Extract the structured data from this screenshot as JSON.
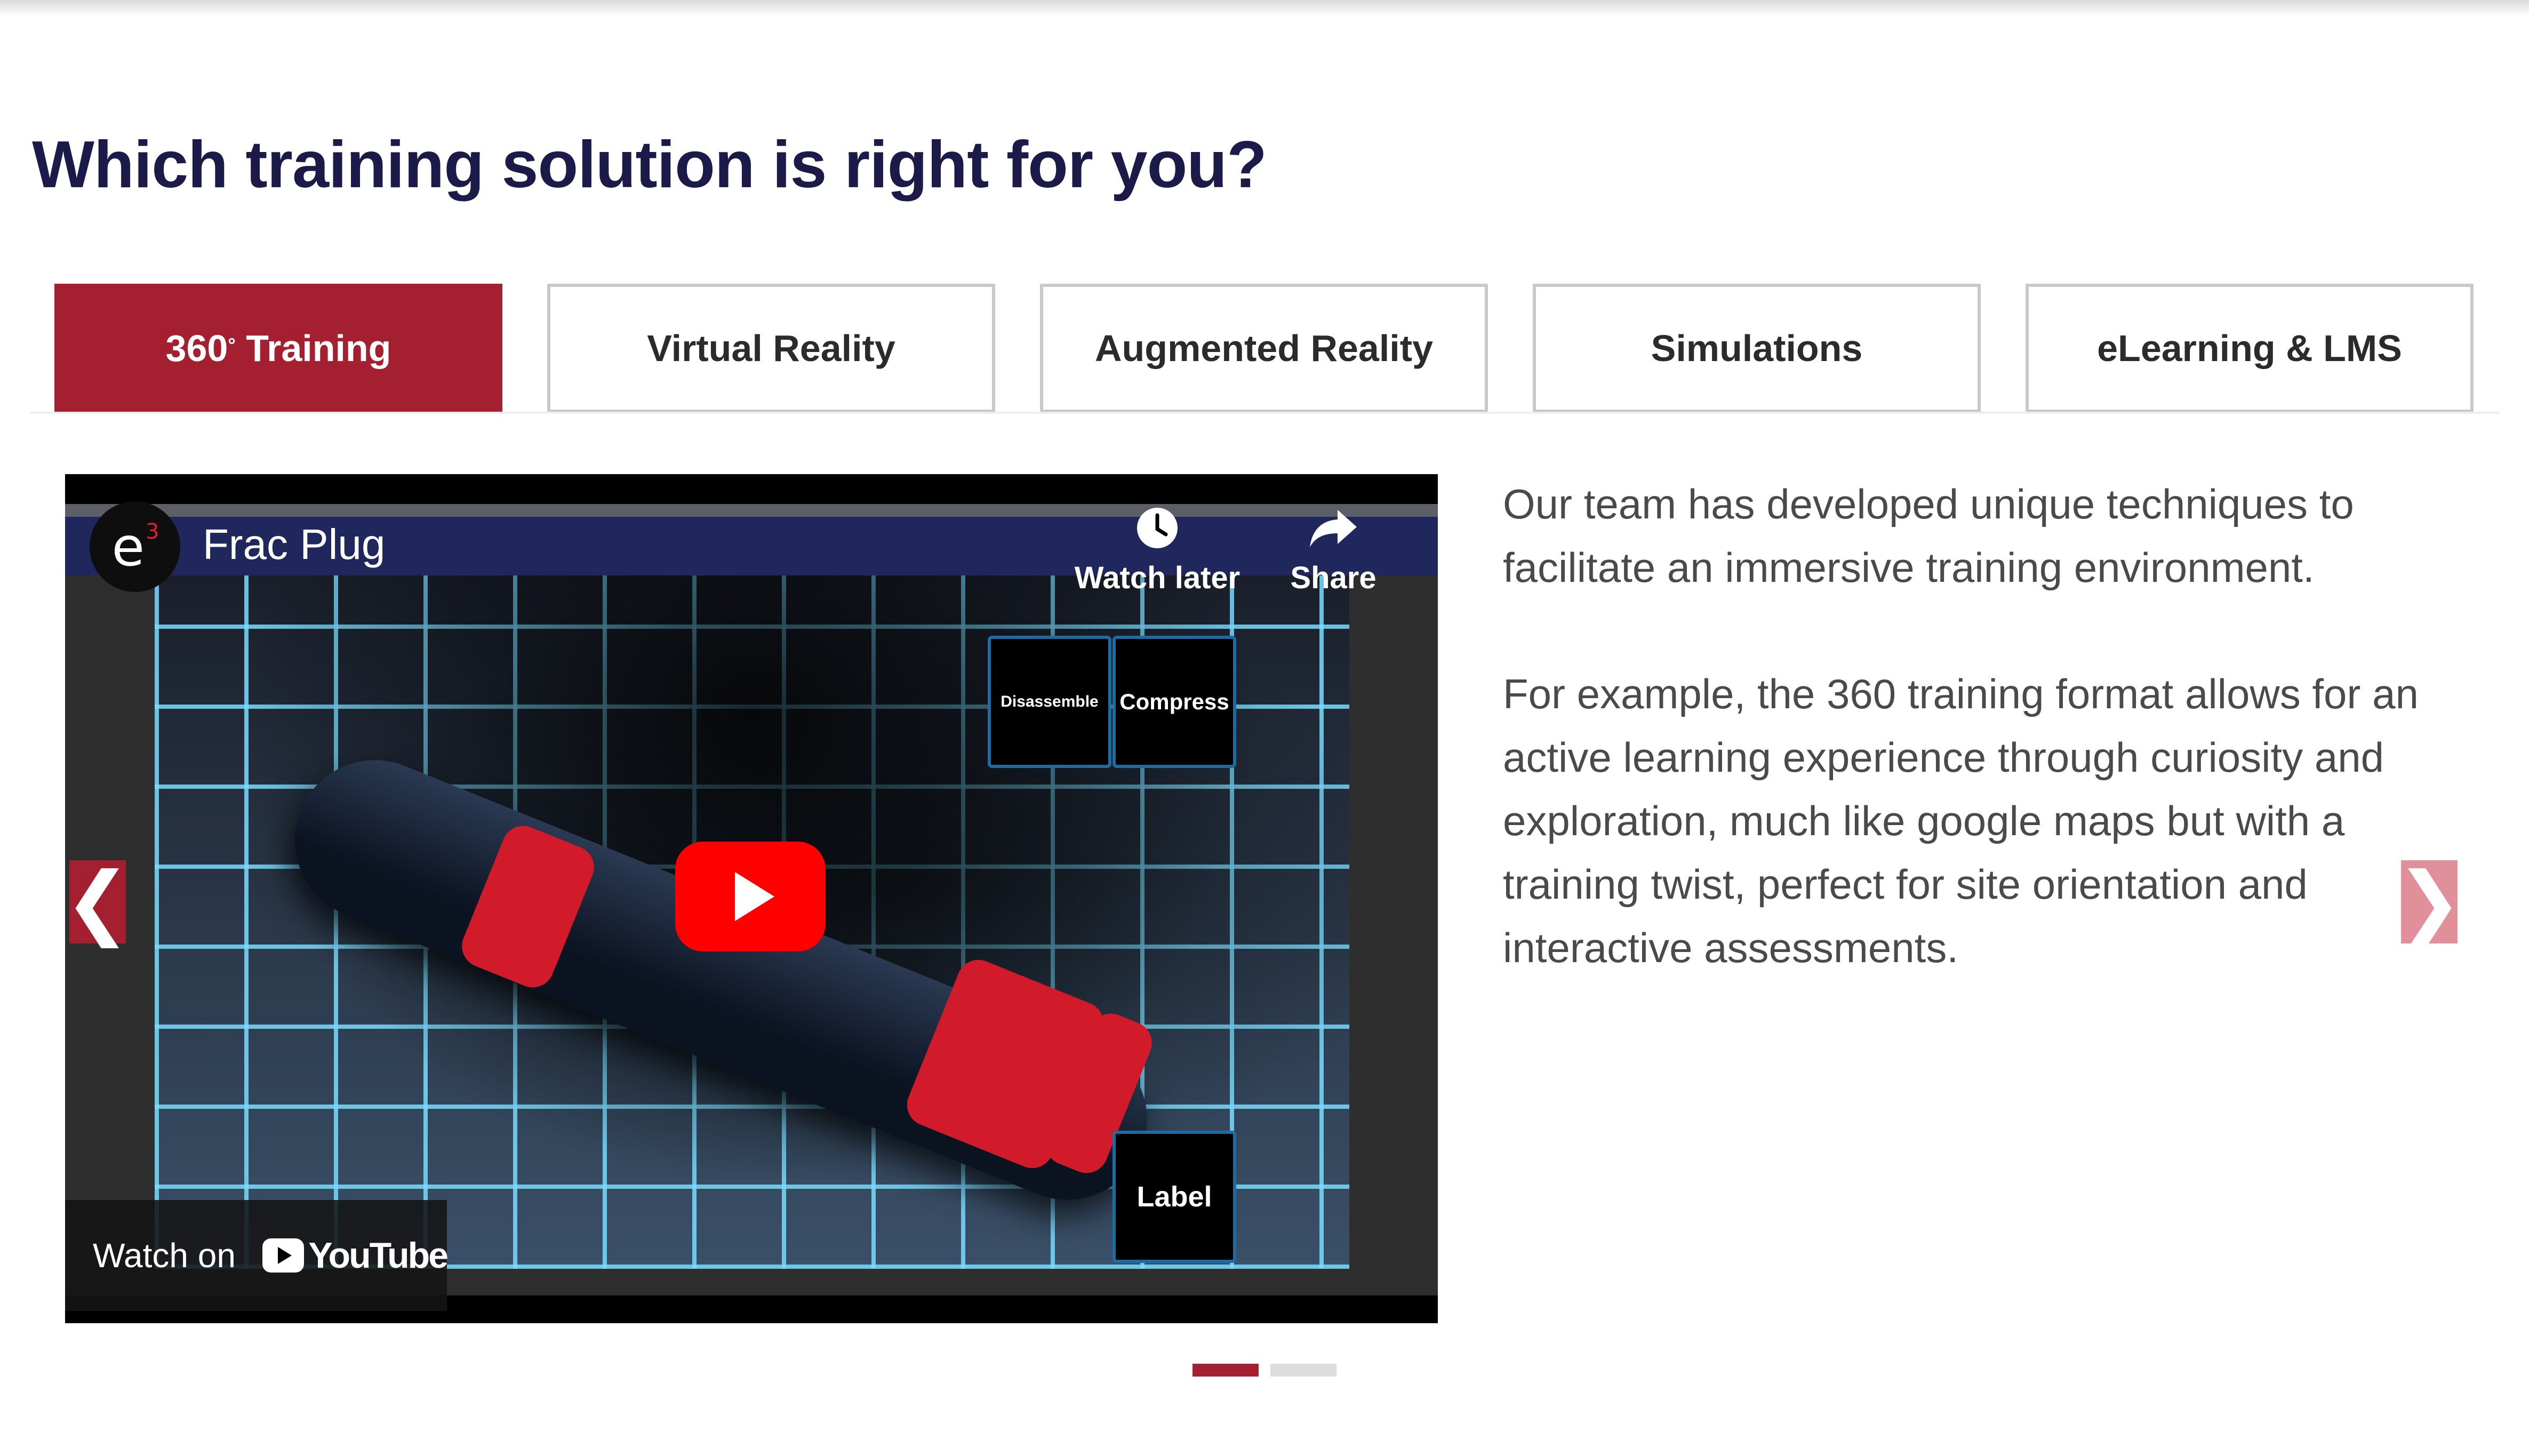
{
  "page": {
    "title": "Which training solution is right for you?"
  },
  "tabs": [
    {
      "label": "360",
      "sup": "°",
      "label_suffix": " Training",
      "active": true
    },
    {
      "label": "Virtual Reality",
      "active": false
    },
    {
      "label": "Augmented Reality",
      "active": false
    },
    {
      "label": "Simulations",
      "active": false
    },
    {
      "label": "eLearning & LMS",
      "active": false
    }
  ],
  "video": {
    "channel_logo": "e",
    "channel_logo_sup": "3",
    "title": "Frac Plug",
    "watch_later_label": "Watch later",
    "share_label": "Share",
    "scene_buttons": {
      "disassemble": "Disassemble",
      "compress": "Compress",
      "label": "Label"
    },
    "watch_on_label": "Watch on",
    "youtube_label": "YouTube",
    "icons": [
      "clock-icon",
      "share-arrow-icon",
      "play-icon",
      "youtube-logo-icon"
    ]
  },
  "description": {
    "paragraph_1": "Our team has developed unique techniques to facilitate an immersive training environment.",
    "paragraph_2": "For example, the 360 training format allows for an active learning experience through curiosity and exploration, much like google maps but with a training twist, perfect for site orientation and interactive assessments."
  },
  "carousel": {
    "prev_glyph": "❮",
    "next_glyph": "❯",
    "slide_count": 2,
    "active_slide": 1
  },
  "colors": {
    "brand_red": "#a41f2f",
    "title_navy": "#1c1a48",
    "arrow_next": "#e1909b",
    "youtube_red": "#ff0000"
  }
}
